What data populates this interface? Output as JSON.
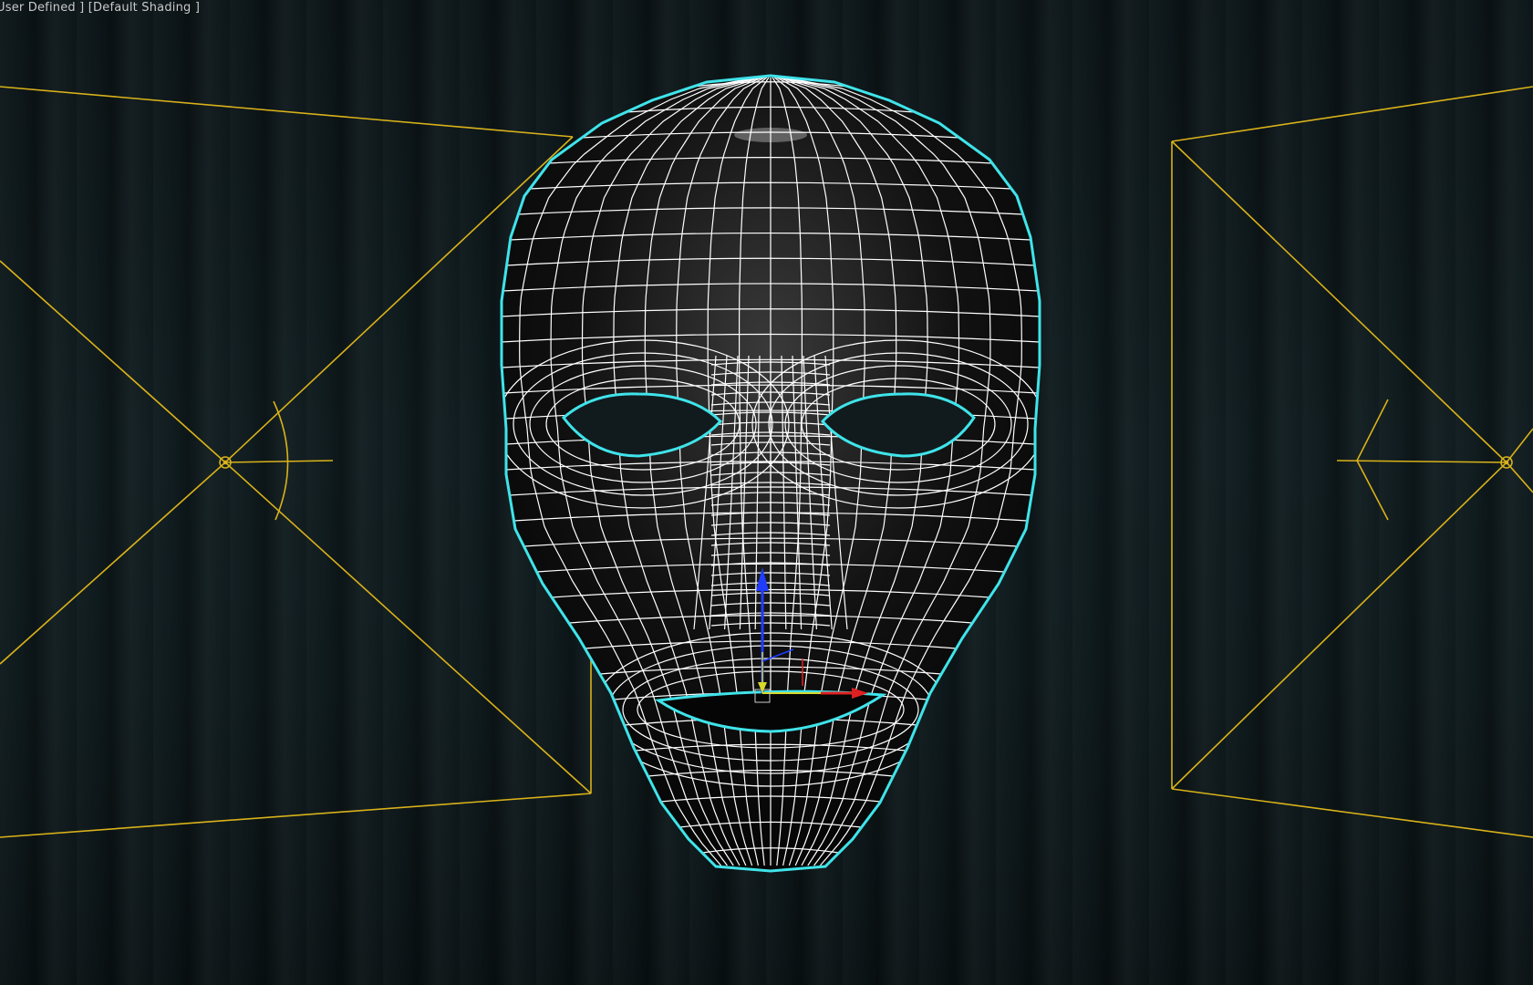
{
  "viewport": {
    "label": "User Defined ] [Default Shading ]"
  },
  "scene": {
    "mesh": "face-mask-wireframe",
    "wire_color": "#ffffff",
    "selection_outline_color": "#3fe4ea",
    "camera_color": "#d9b21a",
    "gizmo_colors": {
      "x": "#e02020",
      "y": "#d8d82a",
      "z": "#1f3cff"
    }
  }
}
